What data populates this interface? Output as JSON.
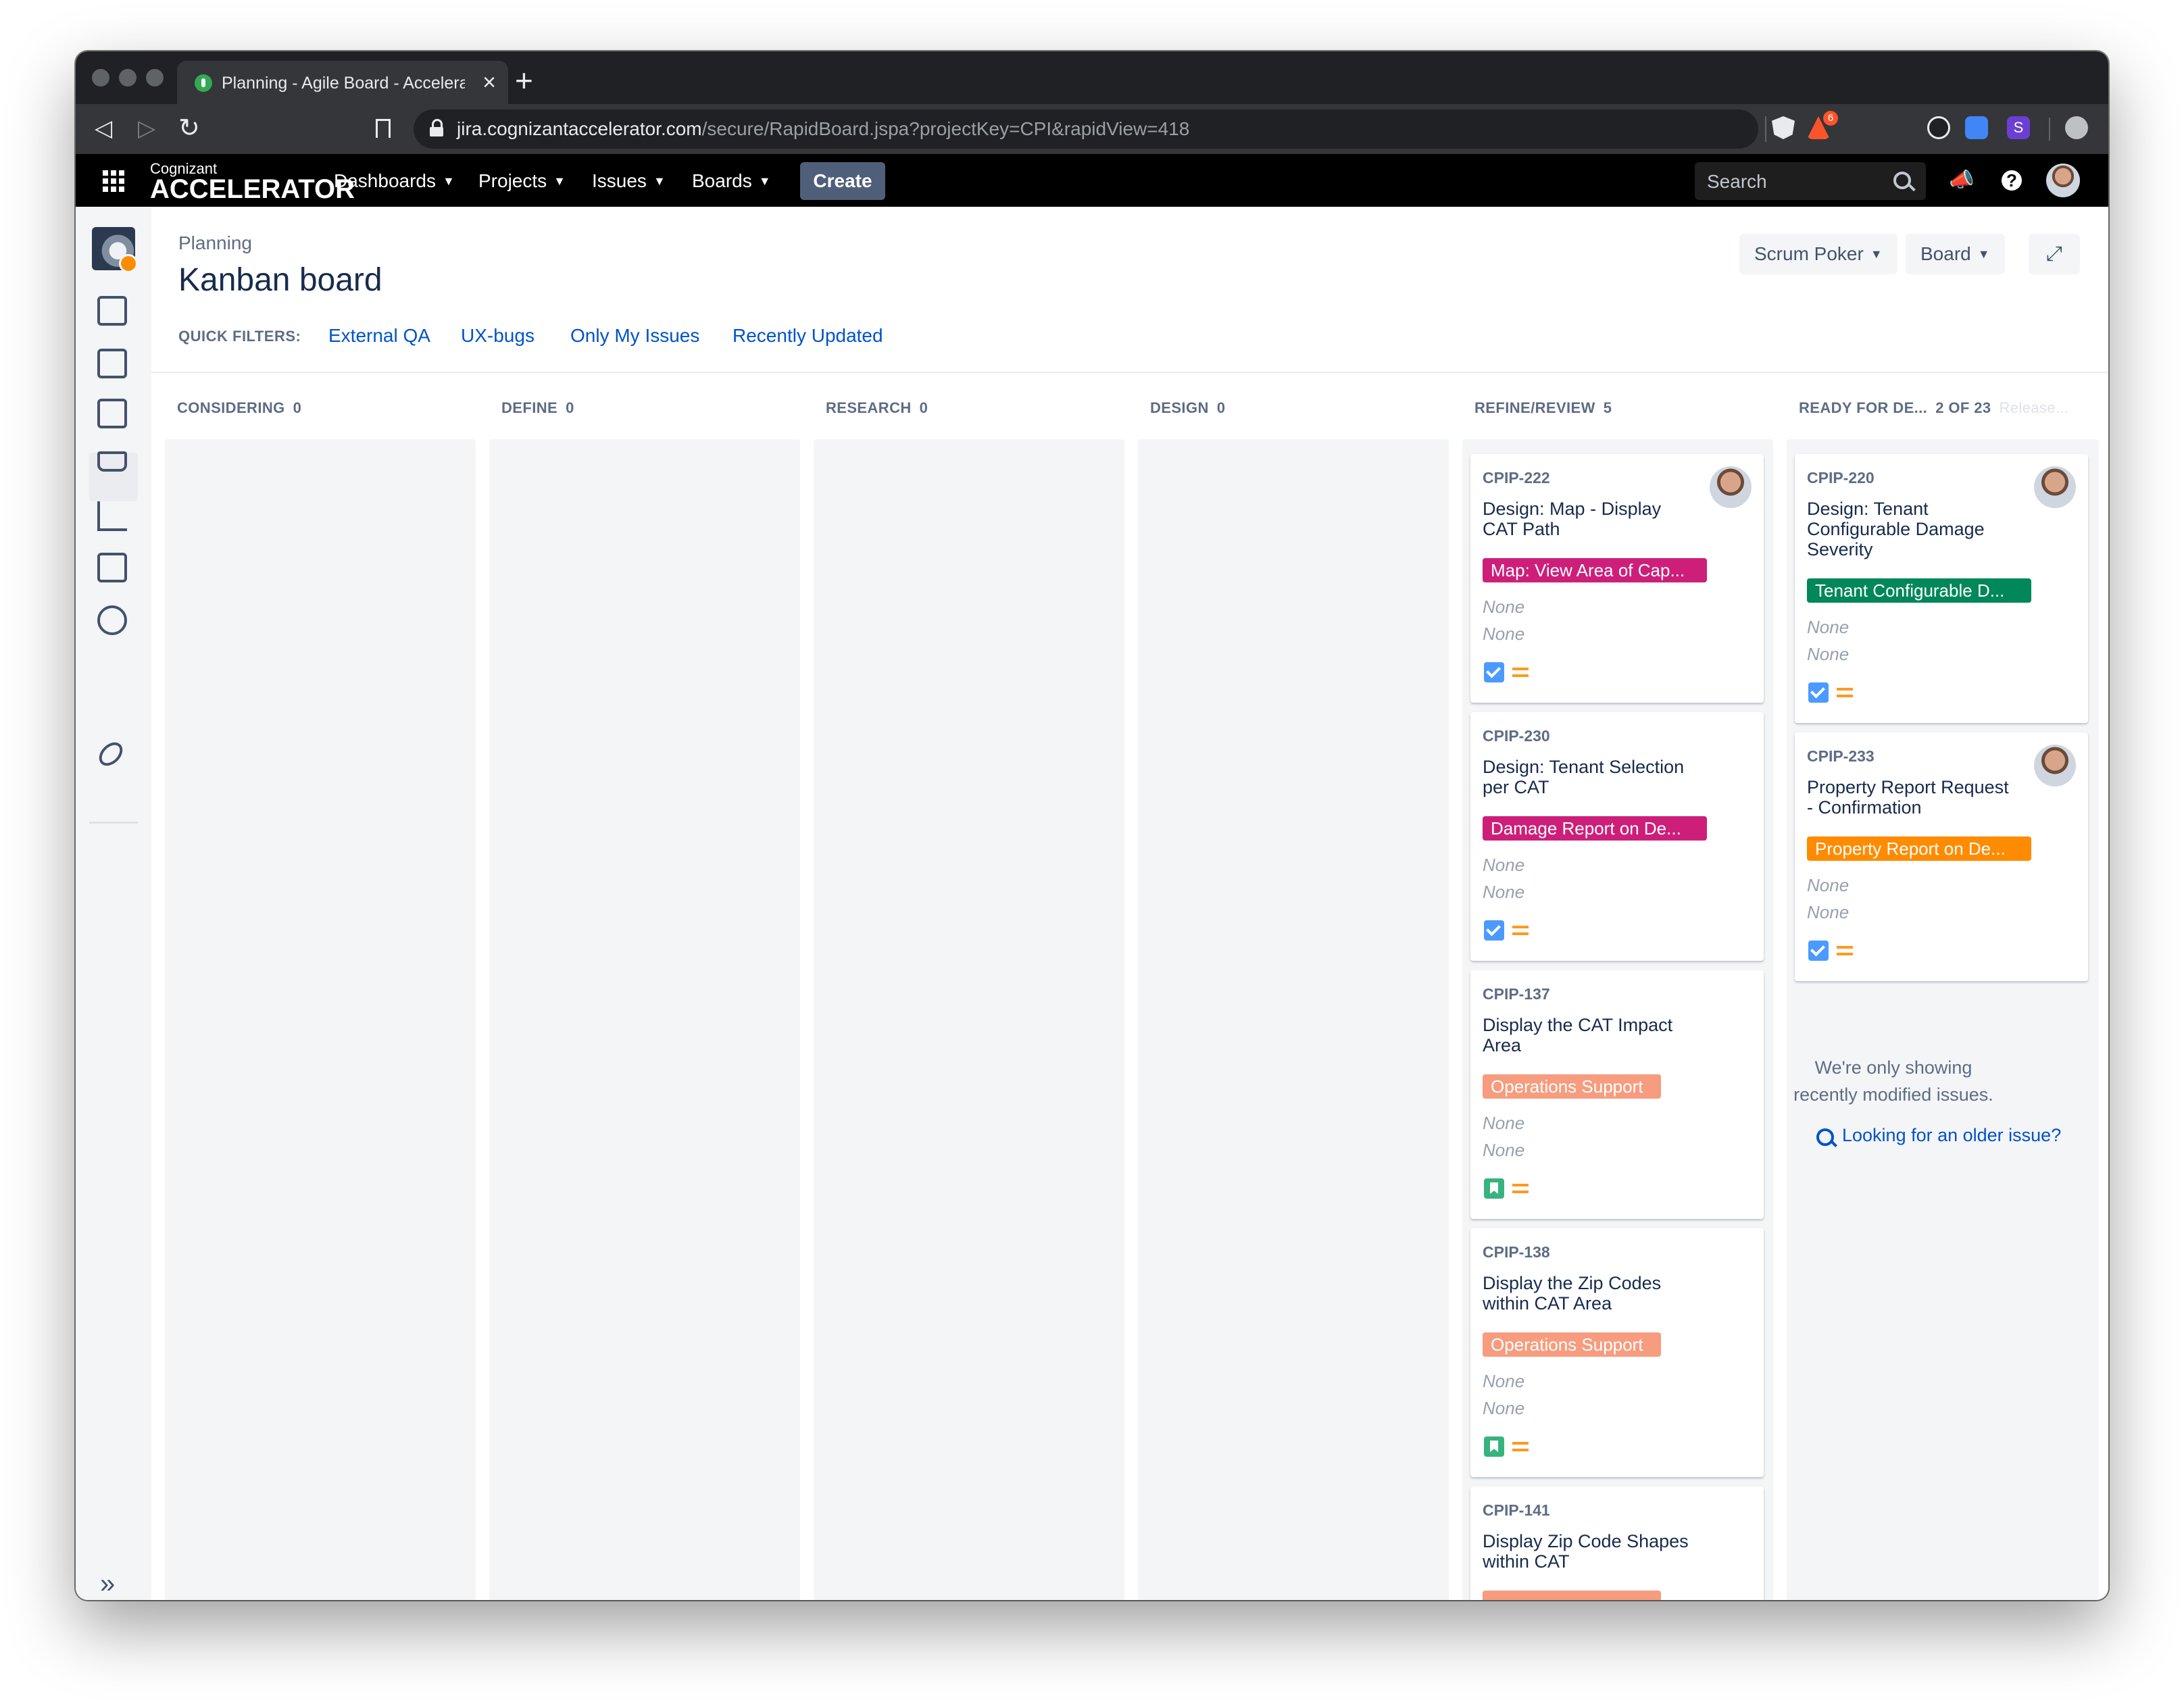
{
  "browser": {
    "tab_title": "Planning - Agile Board - Accelerat",
    "url_host": "jira.cognizantaccelerator.com",
    "url_path": "/secure/RapidBoard.jspa?projectKey=CPI&rapidView=418",
    "extension_badge": "6"
  },
  "jira_nav": {
    "logo_top": "Cognizant",
    "logo_bottom": "ACCELERATOR",
    "menus": [
      "Dashboards",
      "Projects",
      "Issues",
      "Boards"
    ],
    "create_label": "Create",
    "search_placeholder": "Search",
    "help_glyph": "?"
  },
  "page": {
    "breadcrumb": "Planning",
    "title": "Kanban board",
    "quick_filters_label": "QUICK FILTERS:",
    "quick_filters": [
      "External QA",
      "UX-bugs",
      "Only My Issues",
      "Recently Updated"
    ],
    "buttons": {
      "scrum_poker": "Scrum Poker",
      "board": "Board"
    }
  },
  "columns": [
    {
      "name": "CONSIDERING",
      "count": "0"
    },
    {
      "name": "DEFINE",
      "count": "0"
    },
    {
      "name": "RESEARCH",
      "count": "0"
    },
    {
      "name": "DESIGN",
      "count": "0"
    },
    {
      "name": "REFINE/REVIEW",
      "count": "5"
    },
    {
      "name": "READY FOR DE...",
      "count": "2 OF 23",
      "extra": "Release..."
    }
  ],
  "cards": {
    "c222": {
      "key": "CPIP-222",
      "summary": "Design: Map - Display CAT Path",
      "epic": "Map: View Area of Cap...",
      "epic_color": "#cd1f7a",
      "field1": "None",
      "field2": "None",
      "type": "task",
      "priority": "medium"
    },
    "c230": {
      "key": "CPIP-230",
      "summary": "Design: Tenant Selection per CAT",
      "epic": "Damage Report on De...",
      "epic_color": "#cd1f7a",
      "field1": "None",
      "field2": "None",
      "type": "task",
      "priority": "medium"
    },
    "c137": {
      "key": "CPIP-137",
      "summary": "Display the CAT Impact Area",
      "epic": "Operations Support",
      "epic_color": "#f79c7e",
      "field1": "None",
      "field2": "None",
      "type": "story",
      "priority": "medium"
    },
    "c138": {
      "key": "CPIP-138",
      "summary": "Display the Zip Codes within CAT Area",
      "epic": "Operations Support",
      "epic_color": "#f79c7e",
      "field1": "None",
      "field2": "None",
      "type": "story",
      "priority": "medium"
    },
    "c141": {
      "key": "CPIP-141",
      "summary": "Display Zip Code Shapes within CAT",
      "epic_color": "#f79c7e"
    },
    "c220": {
      "key": "CPIP-220",
      "summary": "Design: Tenant Configurable Damage Severity",
      "epic": "Tenant Configurable D...",
      "epic_color": "#00875a",
      "field1": "None",
      "field2": "None",
      "type": "task",
      "priority": "medium"
    },
    "c233": {
      "key": "CPIP-233",
      "summary": "Property Report Request - Confirmation",
      "epic": "Property Report on De...",
      "epic_color": "#ff8b00",
      "field1": "None",
      "field2": "None",
      "type": "task",
      "priority": "medium"
    }
  },
  "notice": {
    "text": "We're only showing recently modified issues.",
    "link": "Looking for an older issue?"
  }
}
